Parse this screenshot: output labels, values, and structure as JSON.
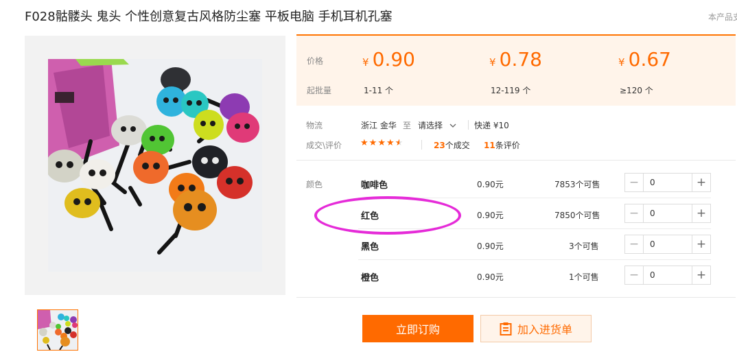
{
  "product": {
    "title": "F028骷髅头 鬼头 个性创意复古风格防尘塞 平板电脑 手机耳机孔塞",
    "top_note": "本产品支"
  },
  "pricing": {
    "price_label": "价格",
    "moq_label": "起批量",
    "currency": "¥",
    "tiers": [
      {
        "price": "0.90",
        "range": "1-11 个"
      },
      {
        "price": "0.78",
        "range": "12-119 个"
      },
      {
        "price": "0.67",
        "range": "≥120 个"
      }
    ]
  },
  "logistics": {
    "label": "物流",
    "origin": "浙江 金华",
    "to": "至",
    "destination": "请选择",
    "shipping": "快递 ¥10"
  },
  "deals": {
    "label": "成交\\评价",
    "rating": 4.5,
    "deals_count": "23",
    "deals_suffix": "个成交",
    "review_count": "11",
    "review_suffix": "条评价"
  },
  "options": {
    "label": "颜色",
    "items": [
      {
        "name": "咖啡色",
        "price": "0.90元",
        "stock": "7853个可售",
        "qty": "0"
      },
      {
        "name": "红色",
        "price": "0.90元",
        "stock": "7850个可售",
        "qty": "0"
      },
      {
        "name": "黑色",
        "price": "0.90元",
        "stock": "3个可售",
        "qty": "0"
      },
      {
        "name": "橙色",
        "price": "0.90元",
        "stock": "1个可售",
        "qty": "0"
      }
    ]
  },
  "actions": {
    "order": "立即订购",
    "cart": "加入进货单"
  },
  "colors": {
    "accent": "#ff6a00",
    "annotation": "#e52bd8",
    "price_bg": "#fff4ea"
  }
}
